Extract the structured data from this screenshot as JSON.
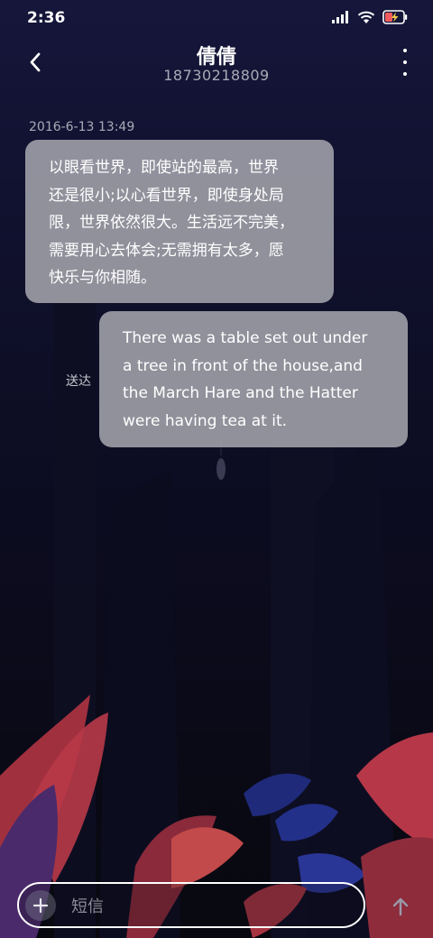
{
  "status_bar": {
    "time": "2:36",
    "icons": [
      "signal-icon",
      "wifi-icon",
      "battery-charging-icon"
    ]
  },
  "header": {
    "back_icon": "back-chevron-icon",
    "contact_name": "倩倩",
    "phone_number": "18730218809",
    "more_icon": "more-vertical-icon"
  },
  "conversation": {
    "timestamp": "2016-6-13 13:49",
    "messages": [
      {
        "direction": "incoming",
        "lines": [
          "以眼看世界，即使站的最高，世界",
          "还是很小;以心看世界，即使身处局",
          "限，世界依然很大。生活远不完美，",
          "需要用心去体会;无需拥有太多，愿",
          "快乐与你相随。"
        ]
      },
      {
        "direction": "outgoing",
        "status": "送达",
        "lines": [
          "There was a table set out under",
          "a tree in front of the house,and",
          "the March Hare and the Hatter",
          "were having tea at it."
        ]
      }
    ]
  },
  "composer": {
    "add_icon": "plus-icon",
    "placeholder": "短信",
    "send_icon": "arrow-up-icon"
  },
  "colors": {
    "background": "#0b0b1c",
    "bubble": "#9c9ca6",
    "muted_text": "#a9a9b6"
  }
}
